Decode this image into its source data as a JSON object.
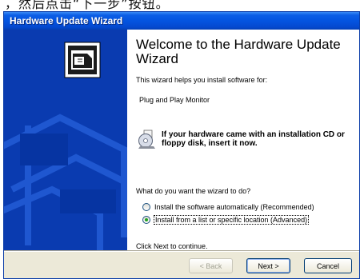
{
  "caption": {
    "text": "，然后点击“下一步”按钮。"
  },
  "window": {
    "title": "Hardware Update Wizard",
    "titlebar_color": "#0454e0",
    "side_panel_color": "#0a3bb0"
  },
  "main": {
    "heading": "Welcome to the Hardware Update Wizard",
    "intro": "This wizard helps you install software for:",
    "device": "Plug and Play Monitor",
    "cd_note": "If your hardware came with an installation CD or floppy disk, insert it now.",
    "question": "What do you want the wizard to do?",
    "options": [
      {
        "label": "Install the software automatically (Recommended)",
        "selected": false
      },
      {
        "label": "Install from a list or specific location (Advanced)",
        "selected": true
      }
    ],
    "next_hint": "Click Next to continue."
  },
  "buttons": {
    "back": "< Back",
    "next": "Next >",
    "cancel": "Cancel"
  },
  "icons": {
    "side": "hardware-card-icon",
    "cd": "cd-disk-icon"
  }
}
